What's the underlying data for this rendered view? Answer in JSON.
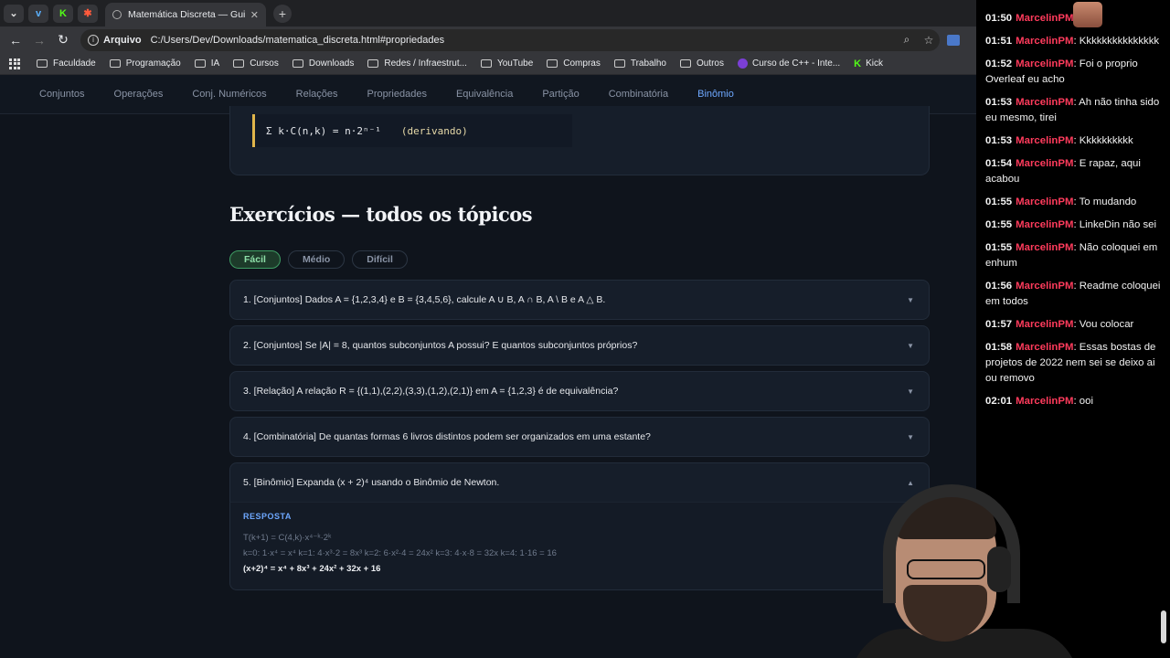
{
  "browser": {
    "tab_title": "Matemática Discreta — Guia Vi",
    "scheme_label": "Arquivo",
    "url": "C:/Users/Dev/Downloads/matematica_discreta.html#propriedades",
    "bookmarks": [
      "Faculdade",
      "Programação",
      "IA",
      "Cursos",
      "Downloads",
      "Redes / Infraestrut...",
      "YouTube",
      "Compras",
      "Trabalho",
      "Outros",
      "Curso de C++ - Inte...",
      "Kick"
    ]
  },
  "nav": {
    "items": [
      "Conjuntos",
      "Operações",
      "Conj. Numéricos",
      "Relações",
      "Propriedades",
      "Equivalência",
      "Partição",
      "Combinatória",
      "Binômio"
    ],
    "active": "Binômio"
  },
  "formula": {
    "expr": "Σ k·C(n,k) = n·2ⁿ⁻¹",
    "note": "(derivando)"
  },
  "exercises": {
    "title": "Exercícios — todos os tópicos",
    "filters": [
      "Fácil",
      "Médio",
      "Difícil"
    ],
    "active_filter": "Fácil",
    "items": [
      {
        "q": "1. [Conjuntos] Dados A = {1,2,3,4} e B = {3,4,5,6}, calcule A ∪ B, A ∩ B, A \\ B e A △ B."
      },
      {
        "q": "2. [Conjuntos] Se |A| = 8, quantos subconjuntos A possui? E quantos subconjuntos próprios?"
      },
      {
        "q": "3. [Relação] A relação R = {(1,1),(2,2),(3,3),(1,2),(2,1)} em A = {1,2,3} é de equivalência?"
      },
      {
        "q": "4. [Combinatória] De quantas formas 6 livros distintos podem ser organizados em uma estante?"
      },
      {
        "q": "5. [Binômio] Expanda (x + 2)⁴ usando o Binômio de Newton."
      }
    ],
    "answer": {
      "label": "RESPOSTA",
      "line1": "T(k+1) = C(4,k)·x⁴⁻ᵏ·2ᵏ",
      "line2": "k=0: 1·x⁴ = x⁴   k=1: 4·x³·2 = 8x³   k=2: 6·x²·4 = 24x²   k=3: 4·x·8 = 32x   k=4: 1·16 = 16",
      "final": "(x+2)⁴ = x⁴ + 8x³ + 24x² + 32x + 16"
    }
  },
  "chat": {
    "user": "MarcelinPM",
    "messages": [
      {
        "time": "01:50",
        "text": ""
      },
      {
        "time": "01:51",
        "text": "Kkkkkkkkkkkkkkk"
      },
      {
        "time": "01:52",
        "text": "Foi o proprio Overleaf eu acho"
      },
      {
        "time": "01:53",
        "text": "Ah não tinha sido eu mesmo, tirei"
      },
      {
        "time": "01:53",
        "text": "Kkkkkkkkkk"
      },
      {
        "time": "01:54",
        "text": "E rapaz, aqui acabou"
      },
      {
        "time": "01:55",
        "text": "To mudando"
      },
      {
        "time": "01:55",
        "text": "LinkeDin não sei"
      },
      {
        "time": "01:55",
        "text": "Não coloquei em enhum"
      },
      {
        "time": "01:56",
        "text": "Readme coloquei em todos"
      },
      {
        "time": "01:57",
        "text": "Vou colocar"
      },
      {
        "time": "01:58",
        "text": "Essas bostas de projetos de 2022 nem sei se deixo ai ou removo"
      },
      {
        "time": "02:01",
        "text": "ooi"
      }
    ]
  }
}
